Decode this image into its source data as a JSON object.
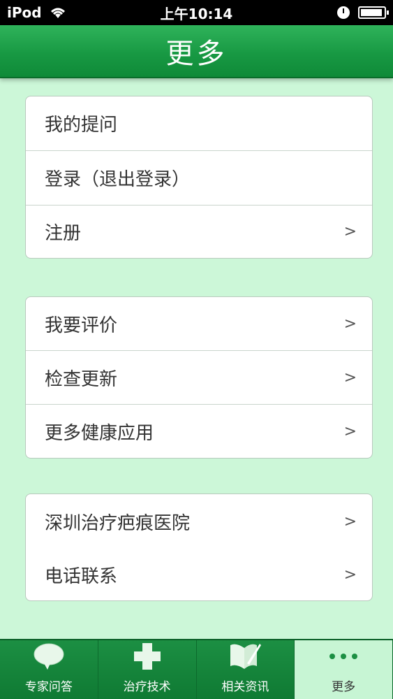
{
  "status_bar": {
    "carrier": "iPod",
    "time": "上午10:14"
  },
  "header": {
    "title": "更多"
  },
  "groups": [
    {
      "items": [
        {
          "label": "我的提问",
          "chevron": ""
        },
        {
          "label": "登录（退出登录）",
          "chevron": ""
        },
        {
          "label": "注册",
          "chevron": ">"
        }
      ]
    },
    {
      "items": [
        {
          "label": "我要评价",
          "chevron": ">"
        },
        {
          "label": "检查更新",
          "chevron": ">"
        },
        {
          "label": "更多健康应用",
          "chevron": ">"
        }
      ]
    },
    {
      "items": [
        {
          "label": "深圳治疗疤痕医院",
          "chevron": ">"
        },
        {
          "label": "电话联系",
          "chevron": ">"
        }
      ]
    }
  ],
  "tabbar": {
    "tabs": [
      {
        "label": "专家问答",
        "icon": "speech-bubble-icon"
      },
      {
        "label": "治疗技术",
        "icon": "medical-cross-icon"
      },
      {
        "label": "相关资讯",
        "icon": "document-pen-icon"
      },
      {
        "label": "更多",
        "icon": "more-dots-icon"
      }
    ],
    "active_index": 3
  },
  "colors": {
    "header_green": "#189943",
    "background_mint": "#ccf7d8",
    "tab_active": "#c7f5d4"
  }
}
